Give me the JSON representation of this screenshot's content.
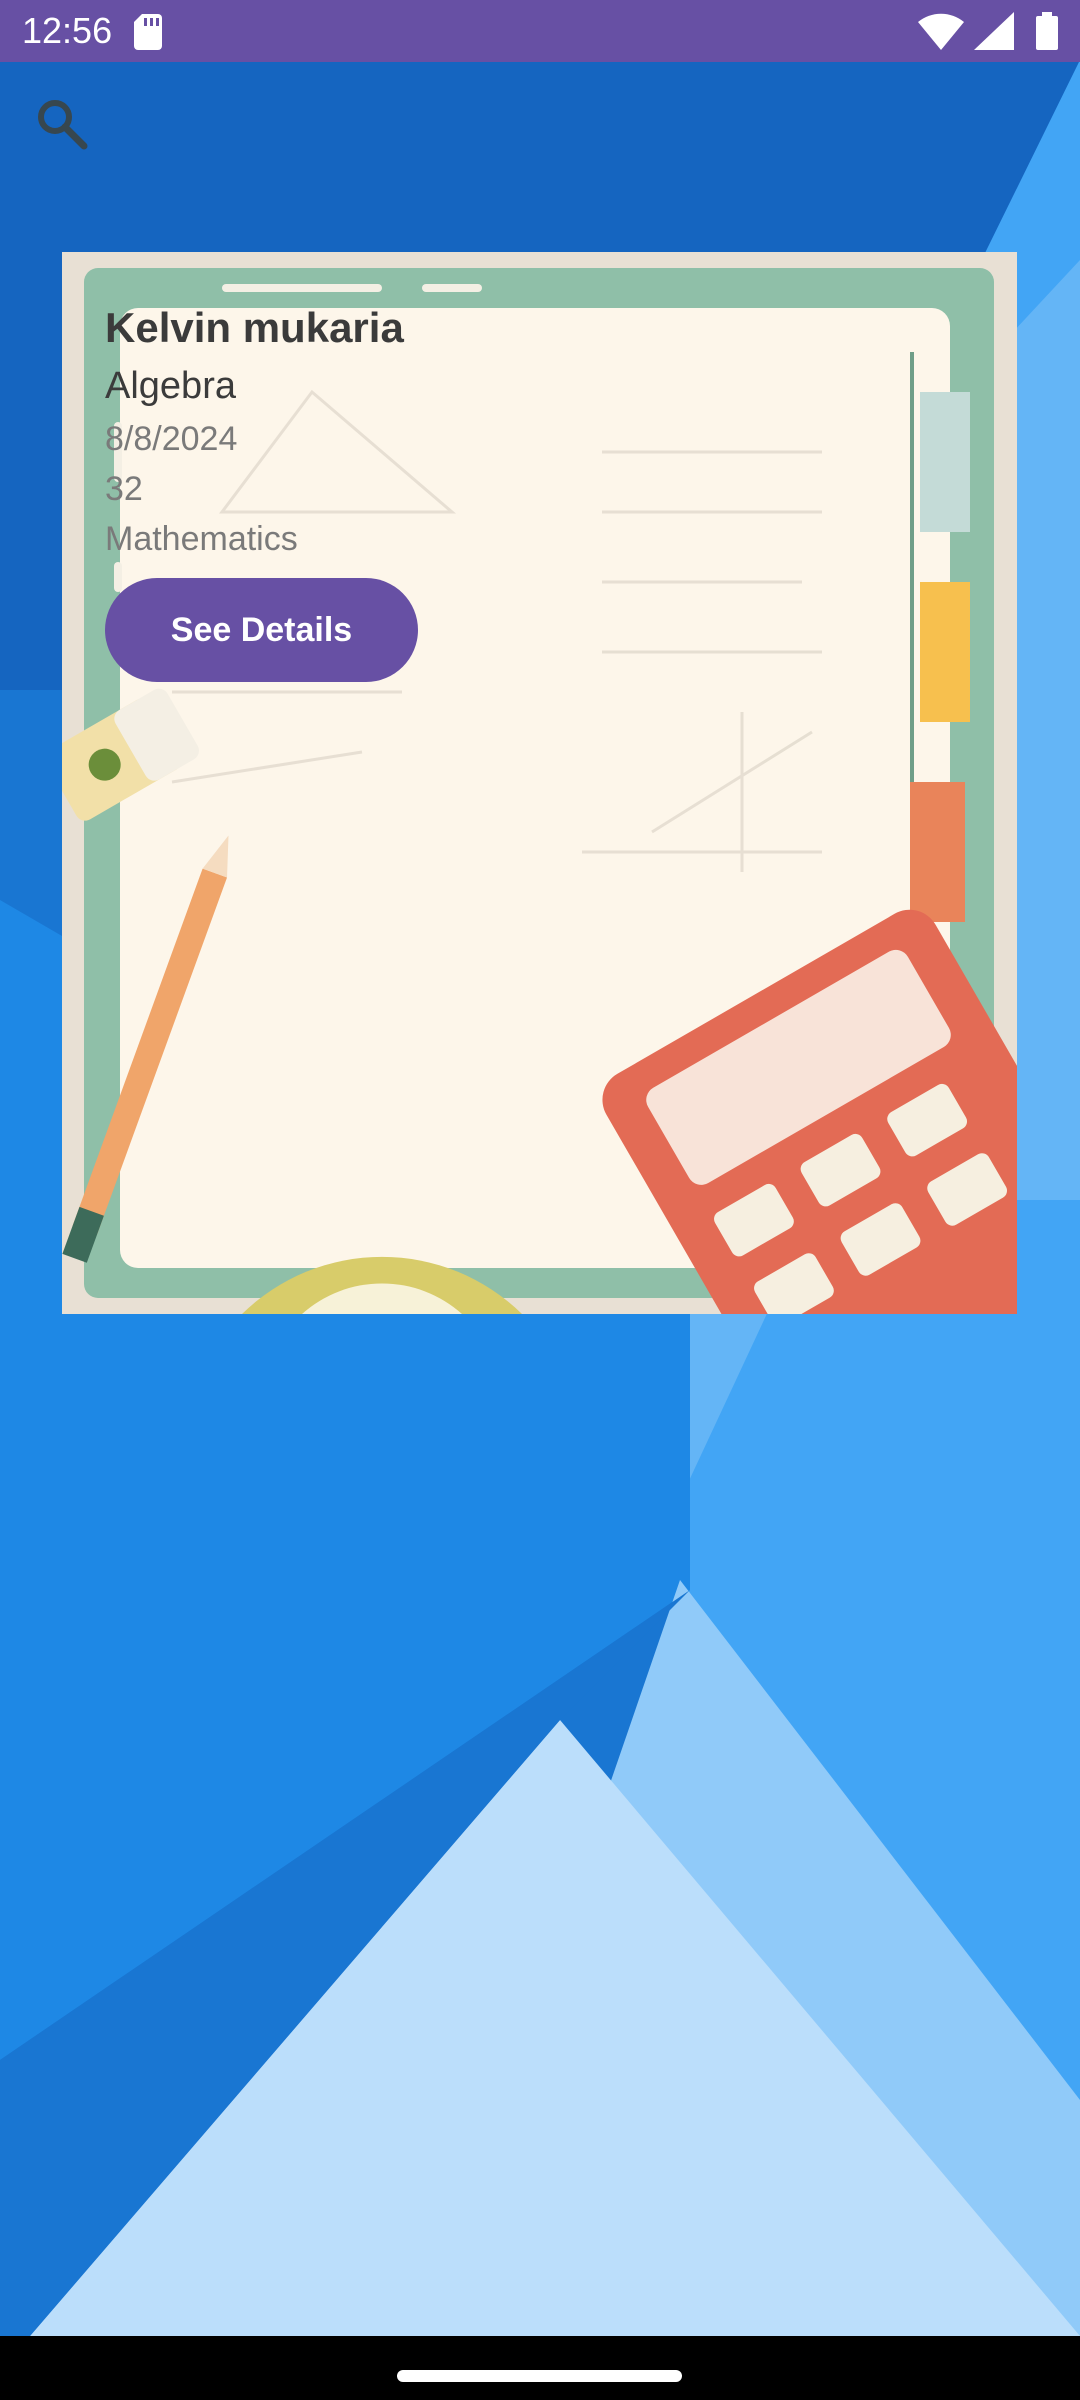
{
  "status_bar": {
    "time": "12:56",
    "icons": [
      "sd-card-icon",
      "wifi-icon",
      "cell-signal-icon",
      "battery-icon"
    ]
  },
  "toolbar": {
    "icon": "search-icon"
  },
  "card": {
    "name": "Kelvin mukaria",
    "topic": "Algebra",
    "date": "8/8/2024",
    "count": "32",
    "subject": "Mathematics",
    "button_label": "See Details"
  },
  "colors": {
    "status_bar": "#6750a4",
    "button": "#6750a4",
    "wallpaper_blue": "#1976d2"
  }
}
